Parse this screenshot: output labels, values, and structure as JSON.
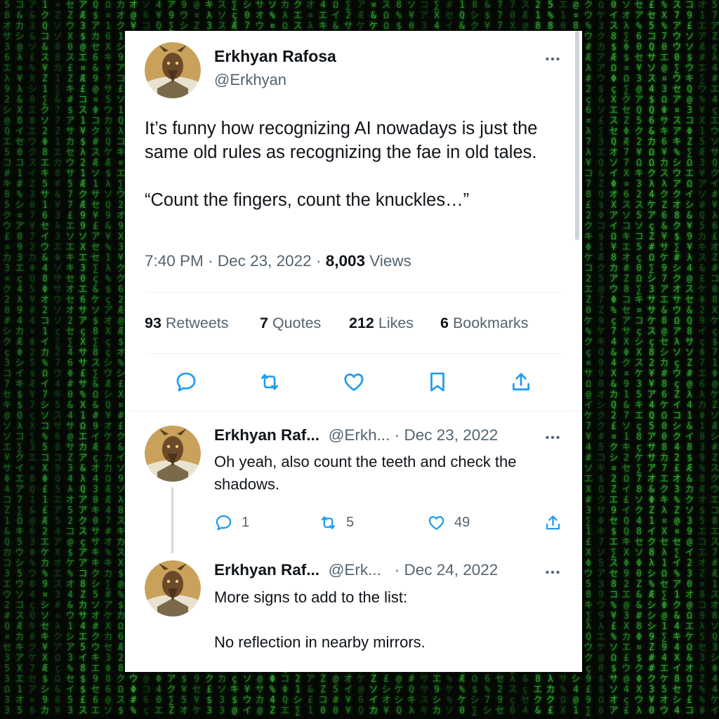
{
  "colors": {
    "matrix_green": "#3bd13b",
    "background": "#050805",
    "text_primary": "#0f1419",
    "text_secondary": "#536471",
    "divider": "#eff3f4"
  },
  "main_tweet": {
    "author_name": "Erkhyan Rafosa",
    "author_handle": "@Erkhyan",
    "text": "It’s funny how recognizing AI nowadays is just the same old rules as recognizing the fae in old tales.\n\n“Count the fingers, count the knuckles…”",
    "time": "7:40 PM",
    "separator": "·",
    "date": "Dec 23, 2022",
    "views_count": "8,003",
    "views_label": "Views",
    "stats": [
      {
        "count": "93",
        "label": "Retweets"
      },
      {
        "count": "7",
        "label": "Quotes"
      },
      {
        "count": "212",
        "label": "Likes"
      },
      {
        "count": "6",
        "label": "Bookmarks"
      }
    ],
    "actions": [
      "reply-icon",
      "retweet-icon",
      "like-icon",
      "bookmark-icon",
      "share-icon"
    ]
  },
  "replies": [
    {
      "author_name": "Erkhyan Raf...",
      "author_handle": "@Erkh...",
      "separator": "·",
      "date": "Dec 23, 2022",
      "text": "Oh yeah, also count the teeth and check the shadows.",
      "reply_count": "1",
      "retweet_count": "5",
      "like_count": "49"
    },
    {
      "author_name": "Erkhyan Raf...",
      "author_handle": "@Erk...",
      "separator": "·",
      "date": "Dec 24, 2022",
      "text": "More signs to add to the list:\n\nNo reflection in nearby mirrors."
    }
  ]
}
